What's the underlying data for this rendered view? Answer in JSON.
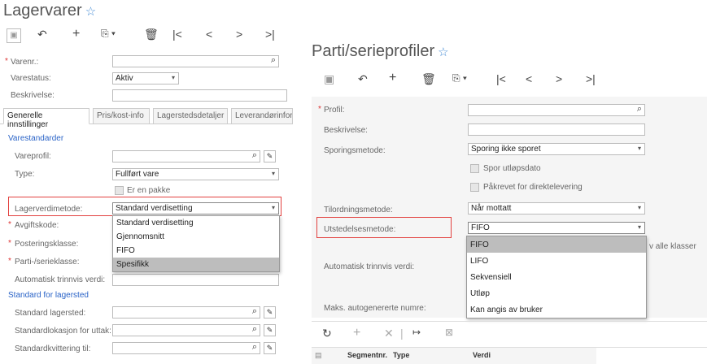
{
  "left": {
    "title": "Lagervarer",
    "toolbar": [
      "save-icon",
      "undo-icon",
      "plus-icon",
      "copy-icon",
      "delete-icon",
      "first-icon",
      "prev-icon",
      "next-icon",
      "last-icon"
    ],
    "fields": {
      "varenr_label": "Varenr.:",
      "varestatus_label": "Varestatus:",
      "varestatus_value": "Aktiv",
      "beskrivelse_label": "Beskrivelse:"
    },
    "tabs": [
      "Generelle innstillinger",
      "Pris/kost-info",
      "Lagerstedsdetaljer",
      "Leverandørinfor"
    ],
    "section1": "Varestandarder",
    "vareprofil_label": "Vareprofil:",
    "type_label": "Type:",
    "type_value": "Fullført vare",
    "er_en_pakke": "Er en pakke",
    "lagerverdi_label": "Lagerverdimetode:",
    "lagerverdi_value": "Standard verdisetting",
    "avgiftskode_label": "Avgiftskode:",
    "posteringsklasse_label": "Posteringsklasse:",
    "parti_label": "Parti-/serieklasse:",
    "auto_label": "Automatisk trinnvis verdi:",
    "dropdown": [
      "Standard verdisetting",
      "Gjennomsnitt",
      "FIFO",
      "Spesifikk"
    ],
    "section2": "Standard for lagersted",
    "std_lagersted_label": "Standard lagersted:",
    "std_lokasjon_label": "Standardlokasjon for uttak:",
    "std_kvittering_label": "Standardkvittering til:"
  },
  "right": {
    "title": "Parti/serieprofiler",
    "profil_label": "Profil:",
    "beskrivelse_label": "Beskrivelse:",
    "sporing_label": "Sporingsmetode:",
    "sporing_value": "Sporing ikke sporet",
    "spor_utlop": "Spor utløpsdato",
    "pakrevet": "Påkrevet for direktelevering",
    "tilordning_label": "Tilordningsmetode:",
    "tilordning_value": "Når mottatt",
    "utstedelse_label": "Utstedelsesmetode:",
    "utstedelse_value": "FIFO",
    "alle_klasser": "v alle klasser",
    "auto_label": "Automatisk trinnvis verdi:",
    "maks_label": "Maks. autogenererte numre:",
    "dropdown": [
      "FIFO",
      "LIFO",
      "Sekvensiell",
      "Utløp",
      "Kan angis av bruker"
    ],
    "grid_headers": [
      "Segmentnr.",
      "Type",
      "Verdi"
    ]
  }
}
